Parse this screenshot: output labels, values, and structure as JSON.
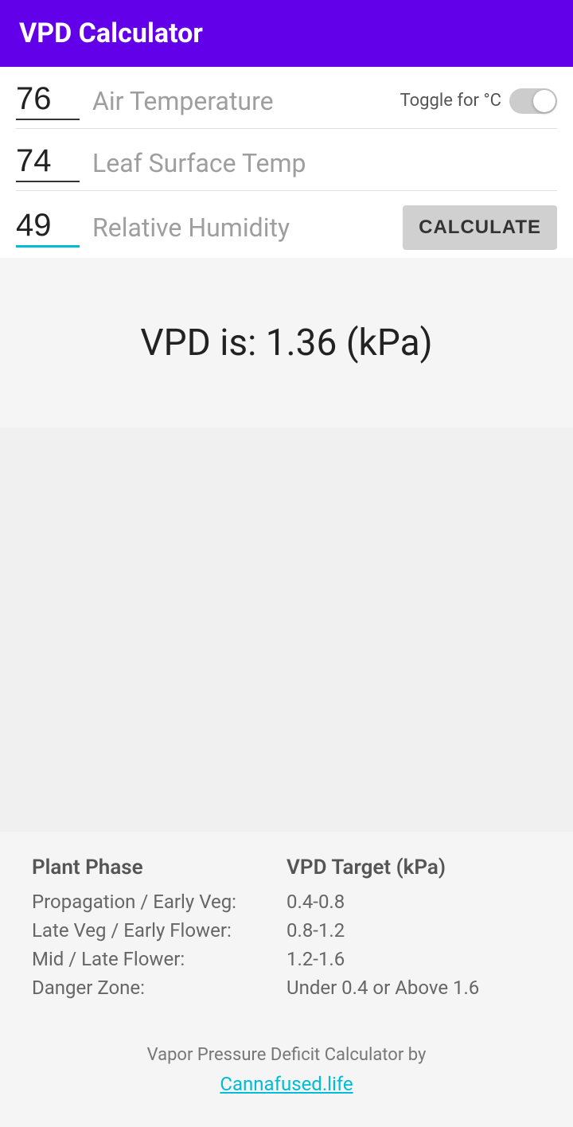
{
  "header": {
    "title": "VPD Calculator"
  },
  "inputs": {
    "air_temp": {
      "value": "76",
      "label": "Air Temperature"
    },
    "leaf_temp": {
      "value": "74",
      "label": "Leaf Surface Temp"
    },
    "humidity": {
      "value": "49",
      "label": "Relative Humidity"
    }
  },
  "toggle": {
    "label": "Toggle for °C"
  },
  "calculate_button": {
    "label": "CALCULATE"
  },
  "result": {
    "text": "VPD is: 1.36 (kPa)"
  },
  "reference": {
    "col1_header": "Plant Phase",
    "col2_header": "VPD Target (kPa)",
    "rows": [
      {
        "phase": "Propagation / Early Veg:",
        "vpd": "0.4-0.8"
      },
      {
        "phase": "Late Veg / Early Flower:",
        "vpd": "0.8-1.2"
      },
      {
        "phase": "Mid / Late Flower:",
        "vpd": "1.2-1.6"
      },
      {
        "phase": "Danger Zone:",
        "vpd": "Under 0.4 or Above 1.6"
      }
    ]
  },
  "footer": {
    "text": "Vapor Pressure Deficit Calculator by",
    "link_text": "Cannafused.life",
    "link_url": "https://cannafused.life"
  }
}
